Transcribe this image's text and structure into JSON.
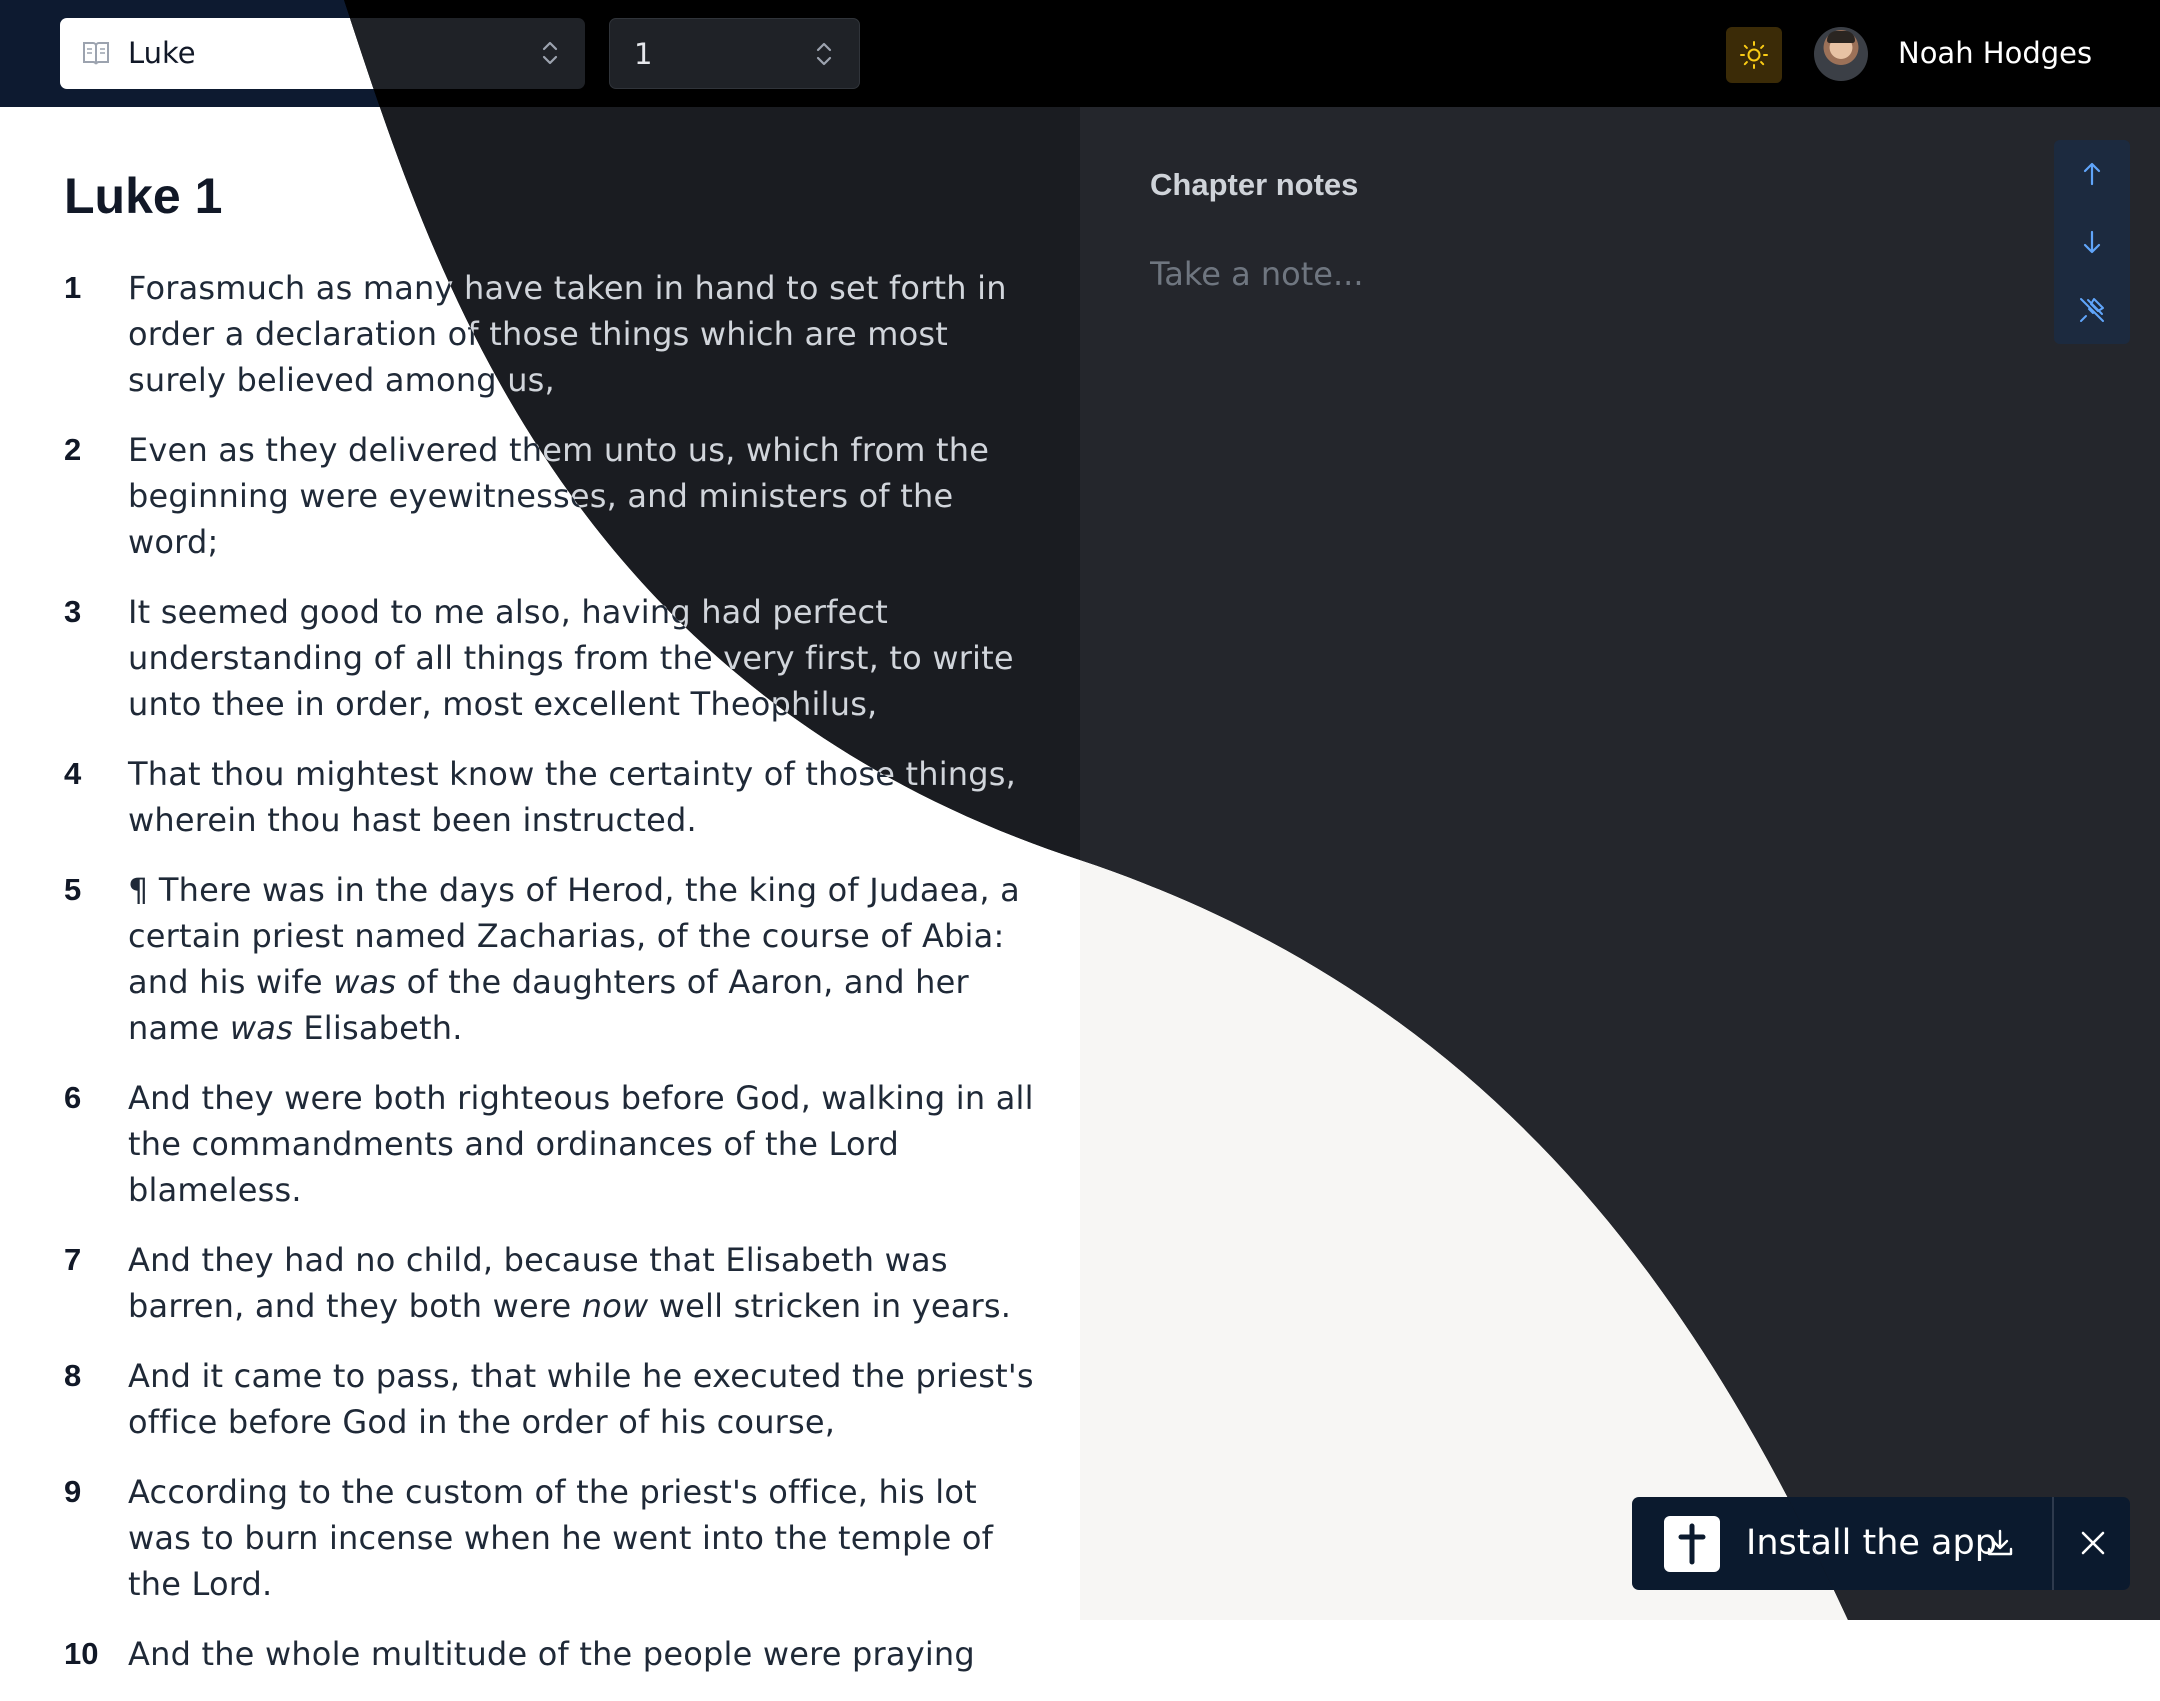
{
  "header": {
    "book_selector": {
      "value": "Luke",
      "icon": "open-book-icon"
    },
    "chapter_selector": {
      "value": "1"
    },
    "theme_toggle": {
      "icon": "sun-icon",
      "color": "#facc15"
    },
    "user": {
      "name": "Noah Hodges"
    }
  },
  "reader": {
    "title": "Luke 1",
    "verses": [
      {
        "n": "1",
        "text": "Forasmuch as many have taken in hand to set forth in order a declaration of those things which are most surely believed among us,"
      },
      {
        "n": "2",
        "text": "Even as they delivered them unto us, which from the beginning were eyewitnesses, and ministers of the word;"
      },
      {
        "n": "3",
        "text": "It seemed good to me also, having had perfect understanding of all things from the very first, to write unto thee in order, most excellent Theophilus,"
      },
      {
        "n": "4",
        "text": "That thou mightest know the certainty of those things, wherein thou hast been instructed."
      },
      {
        "n": "5",
        "parts": [
          "¶ There was in the days of Herod, the king of Judaea, a certain priest named Zacharias, of the course of Abia: and his wife ",
          "was",
          " of the daughters of Aaron, and her name ",
          "was",
          " Elisabeth."
        ]
      },
      {
        "n": "6",
        "text": "And they were both righteous before God, walking in all the commandments and ordinances of the Lord blameless."
      },
      {
        "n": "7",
        "parts": [
          "And they had no child, because that Elisabeth was barren, and they both were ",
          "now",
          " well stricken in years."
        ]
      },
      {
        "n": "8",
        "text": "And it came to pass, that while he executed the priest's office before God in the order of his course,"
      },
      {
        "n": "9",
        "text": "According to the custom of the priest's office, his lot was to burn incense when he went into the temple of the Lord."
      },
      {
        "n": "10",
        "text": "And the whole multitude of the people were praying"
      }
    ]
  },
  "notes": {
    "title": "Chapter notes",
    "placeholder": "Take a note...",
    "tools": [
      {
        "icon": "arrow-up-icon"
      },
      {
        "icon": "arrow-down-icon"
      },
      {
        "icon": "unpin-icon"
      }
    ],
    "tool_color": "#60a5fa"
  },
  "install_banner": {
    "label": "Install the app",
    "logo_icon": "cross-icon",
    "download_icon": "download-icon",
    "close_icon": "close-icon"
  },
  "colors": {
    "light_background": "#ffffff",
    "dark_background": "#24262c",
    "navy": "#0b1a2e"
  }
}
